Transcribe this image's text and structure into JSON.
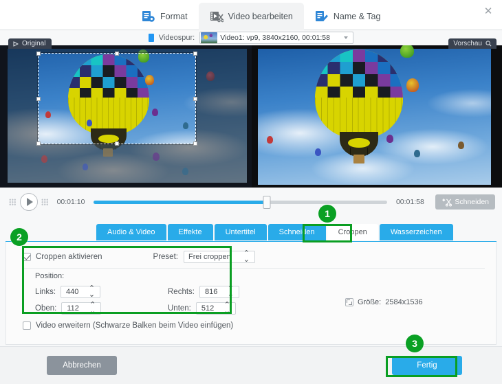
{
  "window": {
    "close_icon": "close-icon"
  },
  "top_tabs": [
    {
      "label": "Format",
      "icon": "format-icon",
      "active": false
    },
    {
      "label": "Video bearbeiten",
      "icon": "video-edit-icon",
      "active": true
    },
    {
      "label": "Name & Tag",
      "icon": "name-tag-icon",
      "active": false
    }
  ],
  "track": {
    "label": "Videospur:",
    "icon": "video-track-icon",
    "selected": "Video1: vp9, 3840x2160, 00:01:58",
    "caret_icon": "chevron-down-icon"
  },
  "preview": {
    "original_label": "Original",
    "original_icon": "play-triangle-icon",
    "preview_label": "Vorschau",
    "preview_icon": "magnifier-icon"
  },
  "player": {
    "play_icon": "play-icon",
    "current_time": "00:01:10",
    "total_time": "00:01:58",
    "progress_percent": 59,
    "cut_button": "Schneiden",
    "cut_icon": "scissors-plus-icon"
  },
  "sub_tabs": [
    {
      "label": "Audio & Video",
      "active": false
    },
    {
      "label": "Effekte",
      "active": false
    },
    {
      "label": "Untertitel",
      "active": false
    },
    {
      "label": "Schneiden",
      "active": false
    },
    {
      "label": "Croppen",
      "active": true
    },
    {
      "label": "Wasserzeichen",
      "active": false
    }
  ],
  "crop": {
    "enable_label": "Croppen aktivieren",
    "enable_checked": true,
    "preset_label": "Preset:",
    "preset_value": "Frei croppen",
    "position_label": "Position:",
    "fields": [
      {
        "label": "Links:",
        "value": "440"
      },
      {
        "label": "Rechts:",
        "value": "816"
      },
      {
        "label": "Oben:",
        "value": "112"
      },
      {
        "label": "Unten:",
        "value": "512"
      }
    ],
    "size_label": "Größe:",
    "size_value": "2584x1536",
    "size_icon": "resize-icon",
    "expand_label": "Video erweitern (Schwarze Balken beim Video einfügen)",
    "expand_checked": false
  },
  "footer": {
    "cancel_label": "Abbrechen",
    "done_label": "Fertig"
  },
  "annotations": {
    "badge_1": "1",
    "badge_2": "2",
    "badge_3": "3",
    "accent_color": "#0aa024"
  }
}
